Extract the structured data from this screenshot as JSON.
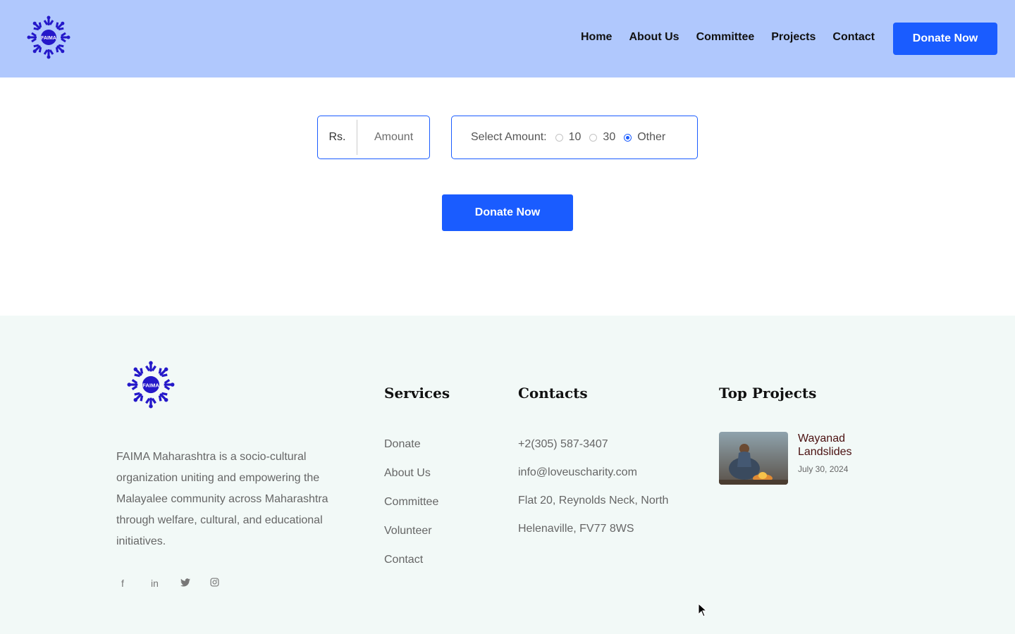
{
  "header": {
    "logo_text": "FAIMA",
    "nav": [
      "Home",
      "About Us",
      "Committee",
      "Projects",
      "Contact"
    ],
    "donate_button": "Donate Now"
  },
  "donation": {
    "currency": "Rs.",
    "amount_placeholder": "Amount",
    "select_label": "Select Amount:",
    "options": [
      {
        "label": "10",
        "selected": false
      },
      {
        "label": "30",
        "selected": false
      },
      {
        "label": "Other",
        "selected": true
      }
    ],
    "submit_label": "Donate Now"
  },
  "footer": {
    "logo_text": "FAIMA",
    "about_text": "FAIMA Maharashtra is a socio-cultural organization uniting and empowering the Malayalee community across Maharashtra through welfare, cultural, and educational initiatives.",
    "social": [
      "facebook-icon",
      "linkedin-icon",
      "twitter-icon",
      "instagram-icon"
    ],
    "services": {
      "title": "Services",
      "items": [
        "Donate",
        "About Us",
        "Committee",
        "Volunteer",
        "Contact"
      ]
    },
    "contacts": {
      "title": "Contacts",
      "items": [
        "+2(305) 587-3407",
        "info@loveuscharity.com",
        "Flat 20, Reynolds Neck, North",
        "Helenaville, FV77 8WS"
      ]
    },
    "top_projects": {
      "title": "Top Projects",
      "items": [
        {
          "title": "Wayanad Landslides",
          "date": "July 30, 2024"
        }
      ]
    }
  },
  "colors": {
    "accent": "#1a5cff",
    "header_bg": "#b0c8fd",
    "footer_bg": "#f2f9f7",
    "logo": "#2418c9"
  }
}
